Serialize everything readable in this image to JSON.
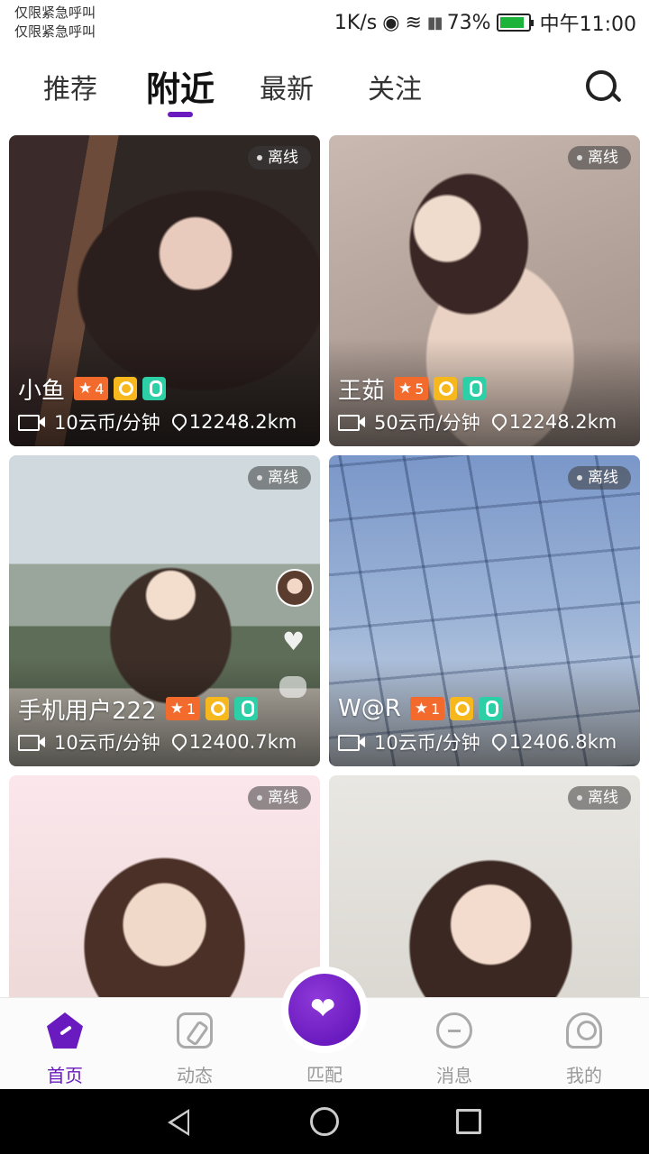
{
  "status_bar": {
    "carrier_line1": "仅限紧急呼叫",
    "carrier_line2": "仅限紧急呼叫",
    "net_speed": "1K/s",
    "battery": "73%",
    "time": "中午11:00"
  },
  "top_tabs": [
    {
      "label": "推荐"
    },
    {
      "label": "附近"
    },
    {
      "label": "最新"
    },
    {
      "label": "关注"
    }
  ],
  "active_tab": "附近",
  "cards": [
    {
      "name": "小鱼",
      "level": "4",
      "status": "离线",
      "price": "10云币/分钟",
      "distance": "12248.2km"
    },
    {
      "name": "王茹",
      "level": "5",
      "status": "离线",
      "price": "50云币/分钟",
      "distance": "12248.2km"
    },
    {
      "name": "手机用户222",
      "level": "1",
      "status": "离线",
      "price": "10云币/分钟",
      "distance": "12400.7km"
    },
    {
      "name": "W@R",
      "level": "1",
      "status": "离线",
      "price": "10云币/分钟",
      "distance": "12406.8km"
    },
    {
      "status": "离线"
    },
    {
      "status": "离线"
    }
  ],
  "bottom_tabs": [
    {
      "label": "首页"
    },
    {
      "label": "动态"
    },
    {
      "label": "匹配"
    },
    {
      "label": "消息"
    },
    {
      "label": "我的"
    }
  ],
  "colors": {
    "accent": "#6a1bbf",
    "level_badge": "#f36a2d",
    "camera_badge": "#f6b81c",
    "mic_badge": "#2ccfa6"
  }
}
